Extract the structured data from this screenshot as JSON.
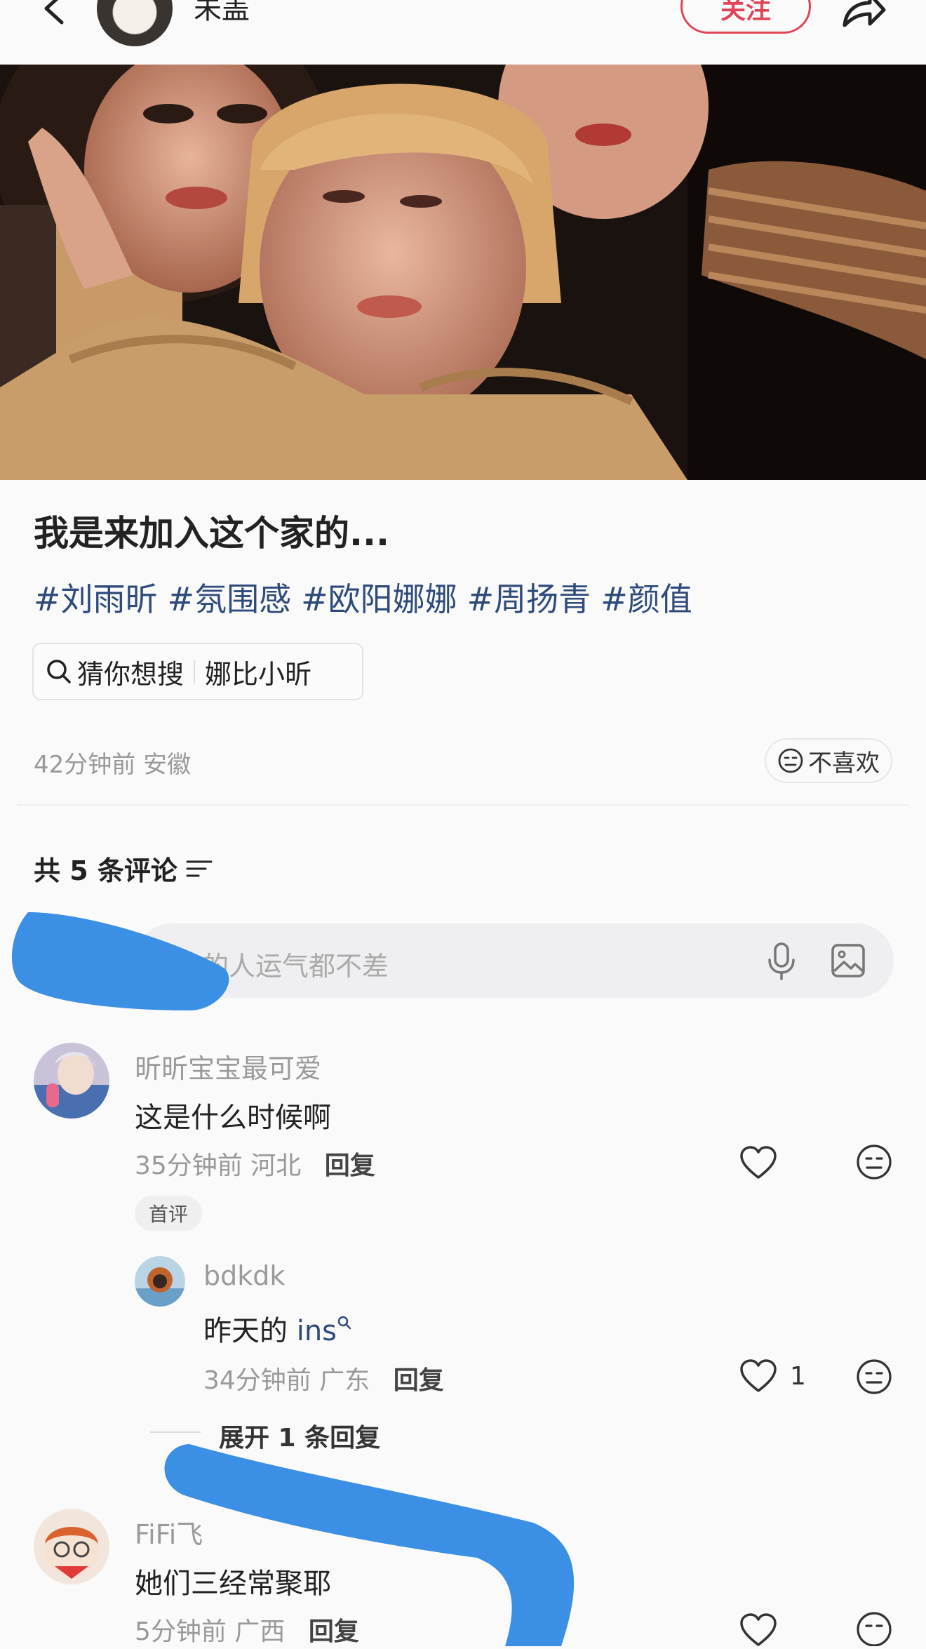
{
  "header": {
    "author_name": "未盖",
    "follow_label": "关注"
  },
  "post": {
    "title": "我是来加入这个家的...",
    "tags": [
      "#刘雨昕",
      "#氛围感",
      "#欧阳娜娜",
      "#周扬青",
      "#颜值"
    ],
    "search_chip": {
      "prefix": "猜你想搜",
      "query": "娜比小昕"
    },
    "time": "42分钟前",
    "location": "安徽",
    "dislike_label": "不喜欢"
  },
  "comments_header": {
    "count_label": "共 5 条评论",
    "input_placeholder": "评论的人运气都不差"
  },
  "comments": [
    {
      "user": "昕昕宝宝最可爱",
      "text": "这是什么时候啊",
      "time": "35分钟前",
      "location": "河北",
      "reply_label": "回复",
      "badge": "首评",
      "replies": [
        {
          "user": "bdkdk",
          "text_prefix": "昨天的 ",
          "text_link": "ins",
          "time": "34分钟前",
          "location": "广东",
          "reply_label": "回复",
          "likes": "1"
        }
      ],
      "expand_label": "展开 1 条回复"
    },
    {
      "user": "FiFi飞",
      "text": "她们三经常聚耶",
      "time": "5分钟前",
      "location": "广西",
      "reply_label": "回复"
    }
  ],
  "colors": {
    "accent": "#e04456",
    "tag": "#2f4b7c",
    "scribble": "#3b8fe4"
  }
}
